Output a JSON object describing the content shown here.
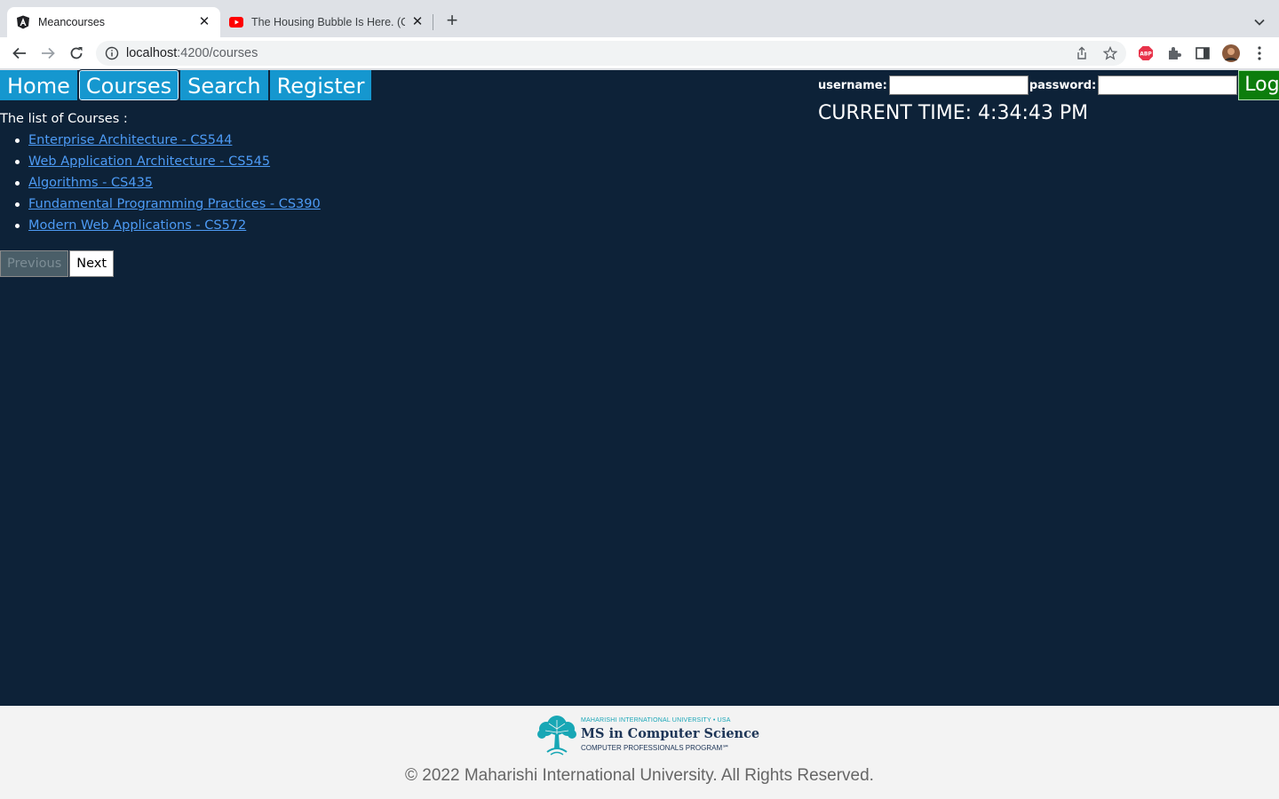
{
  "browser": {
    "tabs": [
      {
        "title": "Meancourses",
        "active": true,
        "icon": "angular-icon"
      },
      {
        "title": "The Housing Bubble Is Here. (C",
        "active": false,
        "icon": "youtube-icon"
      }
    ],
    "url_host": "localhost",
    "url_path": ":4200/courses"
  },
  "nav": {
    "items": [
      {
        "label": "Home",
        "active": false
      },
      {
        "label": "Courses",
        "active": true
      },
      {
        "label": "Search",
        "active": false
      },
      {
        "label": "Register",
        "active": false
      }
    ]
  },
  "login": {
    "username_label": "username:",
    "username_value": "",
    "password_label": "password:",
    "password_value": "",
    "button_label": "Login"
  },
  "clock": {
    "text": "CURRENT TIME: 4:34:43 PM"
  },
  "courses": {
    "heading": "The list of Courses :",
    "items": [
      "Enterprise Architecture - CS544",
      "Web Application Architecture - CS545",
      "Algorithms - CS435",
      "Fundamental Programming Practices - CS390",
      "Modern Web Applications - CS572"
    ]
  },
  "pager": {
    "prev_label": "Previous",
    "next_label": "Next"
  },
  "footer": {
    "logo_line1": "MAHARISHI INTERNATIONAL UNIVERSITY • USA",
    "logo_line2": "MS in Computer Science",
    "logo_line3": "COMPUTER PROFESSIONALS PROGRAM℠",
    "copyright": "© 2022 Maharishi International University. All Rights Reserved."
  },
  "colors": {
    "page_bg": "#0d2238",
    "nav_bg": "#1597cf",
    "login_bg": "#0c7d0c",
    "link": "#4d9bf5"
  }
}
